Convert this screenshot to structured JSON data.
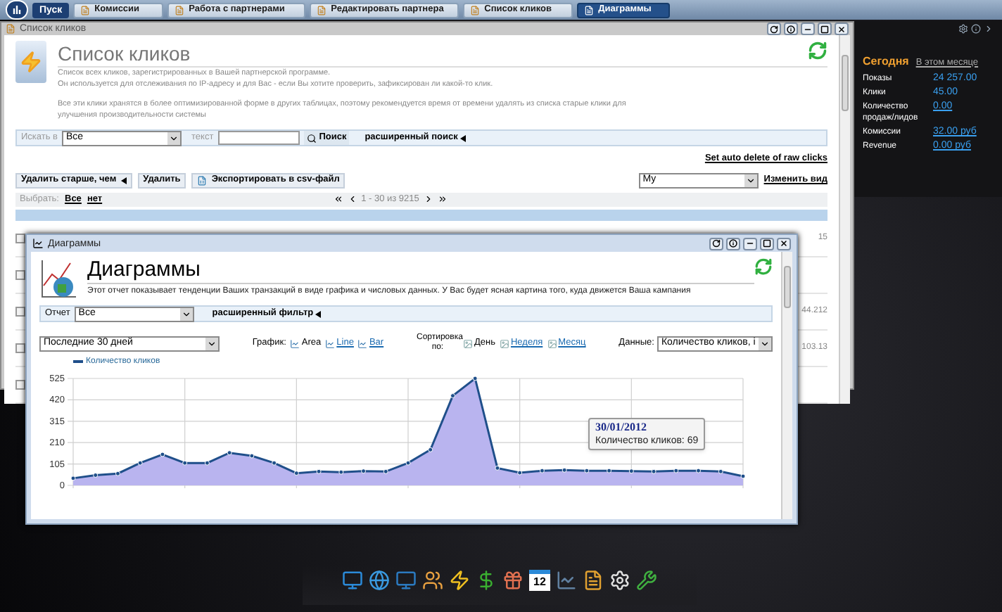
{
  "taskbar": {
    "start": "Пуск",
    "tabs": [
      {
        "label": "Комиссии",
        "selected": false
      },
      {
        "label": "Работа с партнерами",
        "selected": false
      },
      {
        "label": "Редактировать партнера",
        "selected": false
      },
      {
        "label": "Список кликов",
        "selected": false
      },
      {
        "label": "Диаграммы",
        "selected": true
      }
    ]
  },
  "clicks_window": {
    "title": "Список кликов",
    "heading": "Список кликов",
    "description": [
      "Список всех кликов, зарегистрированных в Вашей партнерской программе.",
      "Он используется для отслеживания по IP-адресу и для Вас - если Вы хотите проверить, зафиксирован ли какой-то клик.",
      "Все эти клики хранятся в более оптимизированной форме в других таблицах, поэтому рекомендуется время от времени удалять из списка старые клики для улучшения производительности системы"
    ],
    "search": {
      "label": "Искать в",
      "scope": "Все",
      "text_label": "текст",
      "button": "Поиск",
      "advanced": "расширенный поиск"
    },
    "auto_delete_link": "Set auto delete of raw clicks",
    "actions": [
      {
        "label": "Удалить старше, чем",
        "kind": "menu"
      },
      {
        "label": "Удалить",
        "kind": "plain"
      },
      {
        "label": "Экспортировать в csv-файл",
        "kind": "export"
      }
    ],
    "view": {
      "value": "My",
      "link": "Изменить вид"
    },
    "select": {
      "label": "Выбрать:",
      "all": "Все",
      "none": "нет"
    },
    "pager": "1 - 30 из 9215",
    "rows": [
      {
        "checked": false,
        "column_end": "15"
      },
      {
        "checked": false
      },
      {
        "checked": false,
        "column_end": "44.212"
      },
      {
        "checked": false,
        "column_end": "103.13"
      },
      {
        "checked": false
      }
    ]
  },
  "widget": {
    "tabs": [
      {
        "label": "Сегодня",
        "selected": true
      },
      {
        "label": "В этом месяце",
        "selected": false
      }
    ],
    "rows": [
      {
        "label": "Показы",
        "value": "24 257.00",
        "link": false
      },
      {
        "label": "Клики",
        "value": "45.00",
        "link": false
      },
      {
        "label": "Количество продаж/лидов",
        "value": "0.00",
        "link": true
      },
      {
        "label": "Комиссии",
        "value": "32.00 руб",
        "link": true
      },
      {
        "label": "Revenue",
        "value": "0.00 руб",
        "link": true
      }
    ]
  },
  "diagram_window": {
    "title": "Диаграммы",
    "heading": "Диаграммы",
    "description": "Этот отчет показывает тенденции Ваших транзакций в виде графика и числовых данных. У Вас будет ясная картина того, куда движется Ваша кампания",
    "report": {
      "label": "Отчет",
      "value": "Все",
      "advanced": "расширенный фильтр"
    },
    "period": "Последние 30 дней",
    "graph_label": "График:",
    "graph_types": [
      {
        "label": "Area",
        "selected": true
      },
      {
        "label": "Line",
        "selected": false
      },
      {
        "label": "Bar",
        "selected": false
      }
    ],
    "sort_label": "Сортировка по:",
    "sort_options": [
      {
        "label": "День",
        "selected": true
      },
      {
        "label": "Неделя",
        "selected": false
      },
      {
        "label": "Месяц",
        "selected": false
      }
    ],
    "data_label": "Данные:",
    "data_value": "Количество кликов, і",
    "chart_data": {
      "type": "area",
      "grid": true,
      "ylim": [
        0,
        525
      ],
      "yticks": [
        0,
        105,
        210,
        315,
        420,
        525
      ],
      "series": [
        {
          "name": "Количество кликов",
          "color": "#1f4f8a",
          "values": [
            35,
            50,
            58,
            110,
            152,
            110,
            110,
            160,
            145,
            110,
            60,
            68,
            65,
            70,
            68,
            110,
            175,
            440,
            525,
            85,
            62,
            72,
            75,
            72,
            72,
            70,
            68,
            72,
            72,
            68,
            45
          ]
        }
      ]
    },
    "tooltip": {
      "date": "30/01/2012",
      "text": "Количество кликов: 69"
    }
  },
  "dock": {
    "calendar_day": "12"
  }
}
